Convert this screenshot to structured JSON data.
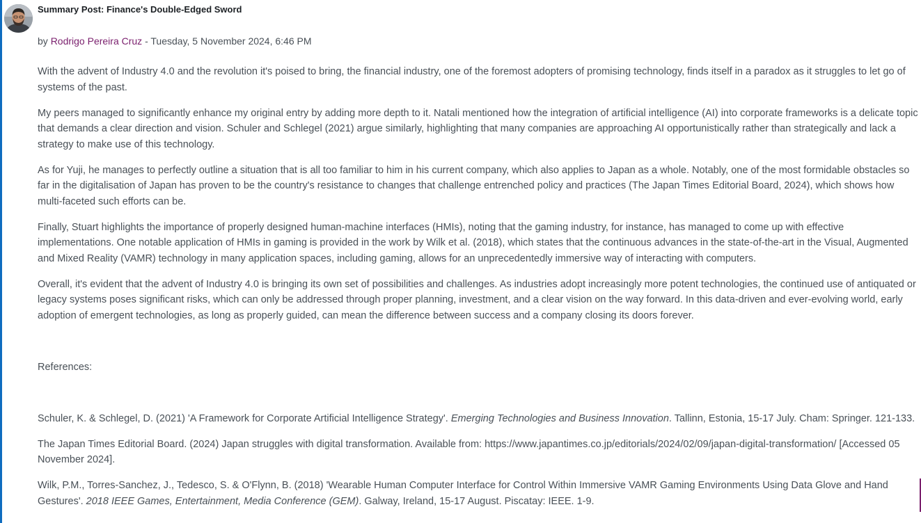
{
  "post": {
    "title": "Summary Post: Finance's Double-Edged Sword",
    "byline_prefix": "by ",
    "author": "Rodrigo Pereira Cruz",
    "byline_separator": " - ",
    "date": "Tuesday, 5 November 2024, 6:46 PM"
  },
  "body": {
    "paragraphs": [
      "With the advent of Industry 4.0 and the revolution it's poised to bring, the financial industry, one of the foremost adopters of promising technology, finds itself in a paradox as it struggles to let go of systems of the past.",
      "My peers managed to significantly enhance my original entry by adding more depth to it. Natali mentioned how the integration of artificial intelligence (AI) into corporate frameworks is a delicate topic that demands a clear direction and vision. Schuler and Schlegel (2021) argue similarly, highlighting that many companies are approaching AI opportunistically rather than strategically and lack a strategy to make use of this technology.",
      "As for Yuji, he manages to perfectly outline a situation that is all too familiar to him in his current company, which also applies to Japan as a whole. Notably, one of the most formidable obstacles so far in the digitalisation of Japan has proven to be the country's resistance to changes that challenge entrenched policy and practices (The Japan Times Editorial Board, 2024), which shows how multi-faceted such efforts can be.",
      "Finally, Stuart highlights the importance of properly designed human-machine interfaces (HMIs), noting that the gaming industry, for instance, has managed to come up with effective implementations. One notable application of HMIs in gaming is provided in the work by Wilk et al. (2018), which states that the continuous advances in the state-of-the-art in the Visual, Augmented and Mixed Reality (VAMR) technology in many application spaces, including gaming, allows for an unprecedentedly immersive way of interacting with computers.",
      "Overall, it's evident that the advent of Industry 4.0 is bringing its own set of possibilities and challenges. As industries adopt increasingly more potent technologies, the continued use of antiquated or legacy systems poses significant risks, which can only be addressed through proper planning, investment, and a clear vision on the way forward. In this data-driven and ever-evolving world, early adoption of emergent technologies, as long as properly guided, can mean the difference between success and a company closing its doors forever."
    ],
    "references_heading": "References:",
    "references": [
      {
        "pre": "Schuler, K. & Schlegel, D. (2021) 'A Framework for Corporate Artificial Intelligence Strategy'. ",
        "italic": "Emerging Technologies and Business Innovation",
        "post": ". Tallinn, Estonia, 15-17 July. Cham: Springer. 121-133."
      },
      {
        "pre": "The Japan Times Editorial Board. (2024) Japan struggles with digital transformation. Available from: https://www.japantimes.co.jp/editorials/2024/02/09/japan-digital-transformation/ [Accessed 05 November 2024].",
        "italic": "",
        "post": ""
      },
      {
        "pre": "Wilk, P.M., Torres-Sanchez, J., Tedesco, S. & O'Flynn, B. (2018) 'Wearable Human Computer Interface for Control Within Immersive VAMR Gaming Environments Using Data Glove and Hand Gestures'. ",
        "italic": "2018 IEEE Games, Entertainment, Media Conference (GEM)",
        "post": ". Galway, Ireland, 15-17 August. Piscatay: IEEE. 1-9."
      }
    ]
  },
  "colors": {
    "accent_blue": "#0f6cbf",
    "link_purple": "#7a1f6d",
    "text": "#495057",
    "title": "#1d2125"
  },
  "icons": {
    "avatar": "user-avatar-photo"
  }
}
